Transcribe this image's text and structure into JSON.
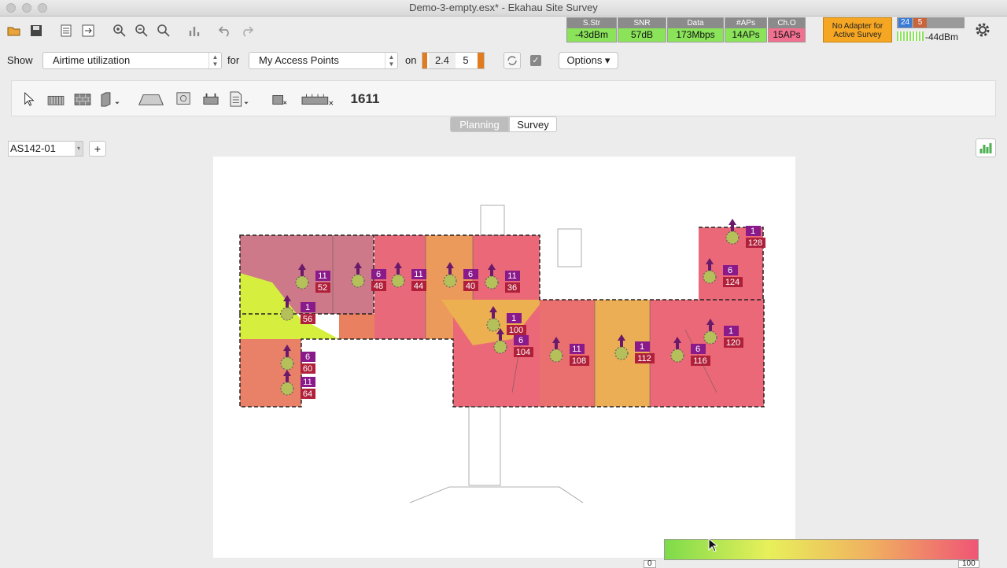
{
  "window": {
    "title": "Demo-3-empty.esx* - Ekahau Site Survey"
  },
  "stats": [
    {
      "label": "S.Str",
      "value": "-43dBm",
      "color": "#8be35a"
    },
    {
      "label": "SNR",
      "value": "57dB",
      "color": "#8be35a"
    },
    {
      "label": "Data",
      "value": "173Mbps",
      "color": "#8be35a"
    },
    {
      "label": "#APs",
      "value": "14APs",
      "color": "#8be35a"
    },
    {
      "label": "Ch.O",
      "value": "15APs",
      "color": "#f07090"
    }
  ],
  "adapter": {
    "text": "No Adapter for Active Survey"
  },
  "signal": {
    "band1": "24",
    "band2": "5",
    "value": "-44dBm"
  },
  "show": {
    "label": "Show",
    "value": "Airtime utilization",
    "for_label": "for",
    "for_value": "My Access Points",
    "on_label": "on",
    "band_a": "2.4",
    "band_b": "5"
  },
  "options": {
    "label": "Options ▾"
  },
  "tabs": {
    "planning": "Planning",
    "survey": "Survey"
  },
  "floor": {
    "name": "AS142-01",
    "add": "+"
  },
  "drawtools": {
    "channel_text": "1611"
  },
  "legend": {
    "min": "0",
    "max": "100"
  },
  "aps": [
    {
      "channel": "11",
      "value": "52"
    },
    {
      "channel": "1",
      "value": "56"
    },
    {
      "channel": "6",
      "value": "48"
    },
    {
      "channel": "11",
      "value": "44"
    },
    {
      "channel": "6",
      "value": "40"
    },
    {
      "channel": "11",
      "value": "36"
    },
    {
      "channel": "6",
      "value": "60"
    },
    {
      "channel": "11",
      "value": "64"
    },
    {
      "channel": "1",
      "value": "100"
    },
    {
      "channel": "6",
      "value": "104"
    },
    {
      "channel": "11",
      "value": "108"
    },
    {
      "channel": "1",
      "value": "112"
    },
    {
      "channel": "6",
      "value": "116"
    },
    {
      "channel": "1",
      "value": "120"
    },
    {
      "channel": "6",
      "value": "124"
    },
    {
      "channel": "1",
      "value": "128"
    }
  ]
}
